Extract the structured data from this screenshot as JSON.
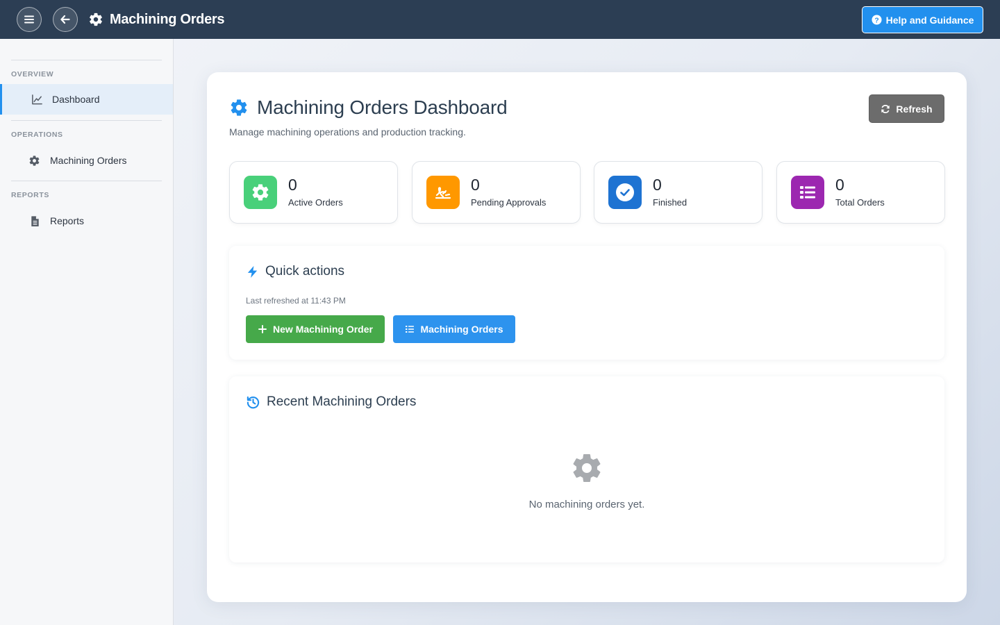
{
  "topbar": {
    "title": "Machining Orders",
    "help_label": "Help and Guidance"
  },
  "sidebar": {
    "sections": [
      {
        "label": "OVERVIEW",
        "items": [
          {
            "label": "Dashboard",
            "icon": "chart-line-icon",
            "active": true
          }
        ]
      },
      {
        "label": "OPERATIONS",
        "items": [
          {
            "label": "Machining Orders",
            "icon": "gear-icon",
            "active": false
          }
        ]
      },
      {
        "label": "REPORTS",
        "items": [
          {
            "label": "Reports",
            "icon": "file-icon",
            "active": false
          }
        ]
      }
    ]
  },
  "header": {
    "title": "Machining Orders Dashboard",
    "subtitle": "Manage machining operations and production tracking.",
    "refresh_label": "Refresh"
  },
  "stats": [
    {
      "value": "0",
      "label": "Active Orders",
      "icon": "gear-icon",
      "color": "#49d07a"
    },
    {
      "value": "0",
      "label": "Pending Approvals",
      "icon": "signature-icon",
      "color": "#ff9800"
    },
    {
      "value": "0",
      "label": "Finished",
      "icon": "check-circle-icon",
      "color": "#1e73d2"
    },
    {
      "value": "0",
      "label": "Total Orders",
      "icon": "list-icon",
      "color": "#9c27b0"
    }
  ],
  "quick_actions": {
    "title": "Quick actions",
    "last_refreshed": "Last refreshed at 11:43 PM",
    "new_order_label": "New Machining Order",
    "orders_label": "Machining Orders"
  },
  "recent": {
    "title": "Recent Machining Orders",
    "empty_text": "No machining orders yet."
  },
  "colors": {
    "topbar": "#2c3e54",
    "accent": "#2290ee",
    "green": "#46a94a",
    "grey_button": "#6c6c6c"
  }
}
